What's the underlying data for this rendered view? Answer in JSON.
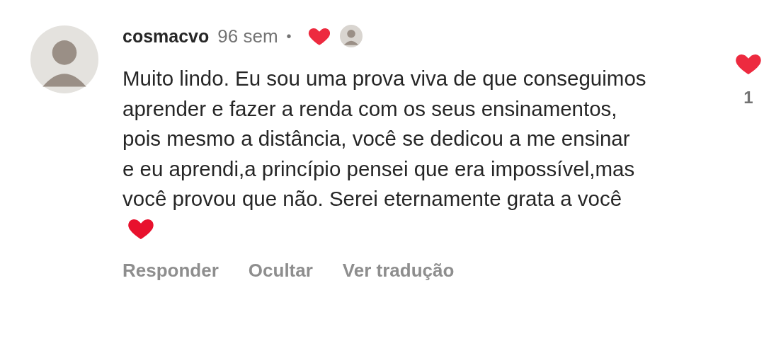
{
  "comment": {
    "username": "cosmacvo",
    "time": "96 sem",
    "separator": "•",
    "liked_by_author": true,
    "text": "Muito lindo. Eu sou uma prova viva de que conseguimos aprender e fazer a renda com os seus ensinamentos, pois mesmo a distância, você se dedicou a me ensinar e eu aprendi,a princípio pensei que era impossível,mas você provou que não. Serei eternamente grata a você",
    "ends_with_heart": true,
    "actions": [
      "Responder",
      "Ocultar",
      "Ver tradução"
    ],
    "like": {
      "liked": true,
      "count": "1"
    }
  }
}
